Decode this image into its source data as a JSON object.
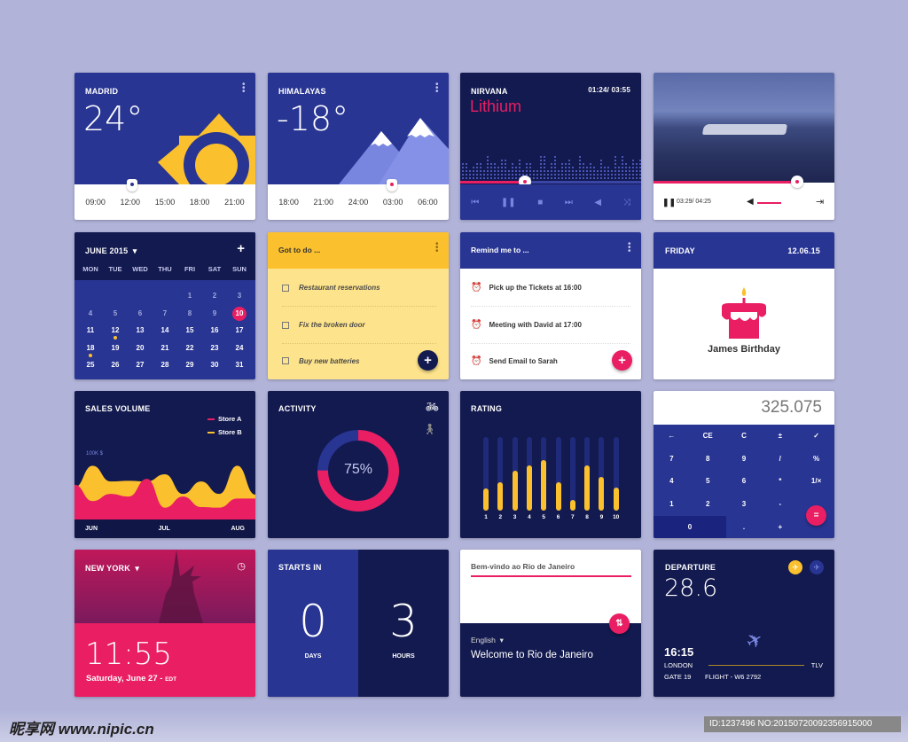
{
  "colors": {
    "background": "#b1b3d9",
    "navy": "#131a4f",
    "blue": "#283593",
    "accent_pink": "#e91e63",
    "accent_yellow": "#fbc02d"
  },
  "weather_madrid": {
    "city": "MADRID",
    "temperature": "24°",
    "times": [
      "09:00",
      "12:00",
      "15:00",
      "18:00",
      "21:00"
    ],
    "selected_time": "12:00",
    "icon": "sun-icon"
  },
  "weather_himalayas": {
    "city": "HIMALAYAS",
    "temperature": "-18°",
    "times": [
      "18:00",
      "21:00",
      "24:00",
      "03:00",
      "06:00"
    ],
    "selected_time": "03:00",
    "icon": "mountain-icon"
  },
  "music": {
    "artist": "NIRVANA",
    "track": "Lithium",
    "time": "01:24/ 03:55",
    "progress": 0.36,
    "controls": [
      "previous-icon",
      "pause-icon",
      "stop-icon",
      "next-icon",
      "volume-icon",
      "shuffle-icon"
    ]
  },
  "video": {
    "time": "03:29/ 04:25",
    "progress": 0.82,
    "volume": 1.0
  },
  "calendar": {
    "month": "JUNE 2015",
    "weekdays": [
      "MON",
      "TUE",
      "WED",
      "THU",
      "FRI",
      "SAT",
      "SUN"
    ],
    "first_weekday_offset": 4,
    "days_in_month": 31,
    "selected_day": 10,
    "event_days": [
      12,
      18
    ]
  },
  "todo": {
    "title": "Got to do ...",
    "items": [
      "Restaurant reservations",
      "Fix the broken door",
      "Buy new batteries"
    ]
  },
  "reminders": {
    "title": "Remind me to ...",
    "items": [
      {
        "text": "Pick up the Tickets at 16:00",
        "active": true
      },
      {
        "text": "Meeting with David at 17:00",
        "active": true
      },
      {
        "text": "Send Email to Sarah",
        "active": false
      }
    ]
  },
  "birthday": {
    "day": "FRIDAY",
    "date": "12.06.15",
    "event": "James Birthday"
  },
  "chart_data": [
    {
      "type": "area",
      "title": "SALES VOLUME",
      "ylabel": "100K $",
      "categories": [
        "JUN",
        "JUL",
        "AUG"
      ],
      "legend": "top-right",
      "series": [
        {
          "name": "Store A",
          "color": "#e91e63",
          "values": [
            0.53,
            0.28,
            0.39,
            0.35,
            0.62,
            0.18,
            0.35,
            0.19,
            0.18,
            0.32,
            0.32
          ]
        },
        {
          "name": "Store B",
          "color": "#fbc02d",
          "values": [
            0.49,
            0.82,
            0.58,
            0.59,
            0.58,
            0.69,
            0.39,
            0.58,
            0.39,
            0.82,
            0.38
          ]
        }
      ]
    },
    {
      "type": "bar",
      "title": "RATING",
      "categories": [
        "1",
        "2",
        "3",
        "4",
        "5",
        "6",
        "7",
        "8",
        "9",
        "10"
      ],
      "values": [
        0.3,
        0.38,
        0.54,
        0.61,
        0.69,
        0.38,
        0.15,
        0.61,
        0.46,
        0.31
      ],
      "ylim": [
        0,
        1
      ]
    }
  ],
  "activity": {
    "title": "ACTIVITY",
    "percent_label": "75%",
    "percent": 0.75
  },
  "calculator": {
    "display": "325.075",
    "keys": [
      "←",
      "CE",
      "C",
      "±",
      "✓",
      "7",
      "8",
      "9",
      "/",
      "%",
      "4",
      "5",
      "6",
      "*",
      "1/×",
      "1",
      "2",
      "3",
      "-",
      "",
      "0",
      "",
      ".",
      "+",
      ""
    ],
    "equals": "="
  },
  "clock": {
    "city": "NEW YORK",
    "time": "11:55",
    "date": "Saturday, June 27 -",
    "timezone": "EDT"
  },
  "countdown": {
    "title": "STARTS IN",
    "days": "0",
    "days_label": "DAYS",
    "hours": "3",
    "hours_label": "HOURS"
  },
  "translate": {
    "source_text": "Bem-vindo ao Rio de Janeiro",
    "language": "English",
    "translated_text": "Welcome to Rio de Janeiro"
  },
  "flight": {
    "title": "DEPARTURE",
    "temperature": "28.6",
    "time": "16:15",
    "from": "LONDON",
    "to": "TLV",
    "gate": "GATE 19",
    "flight": "FLIGHT - W6 2792"
  },
  "watermark": {
    "logo": "昵享网 www.nipic.cn",
    "id": "ID:1237496 NO:20150720092356915000"
  }
}
